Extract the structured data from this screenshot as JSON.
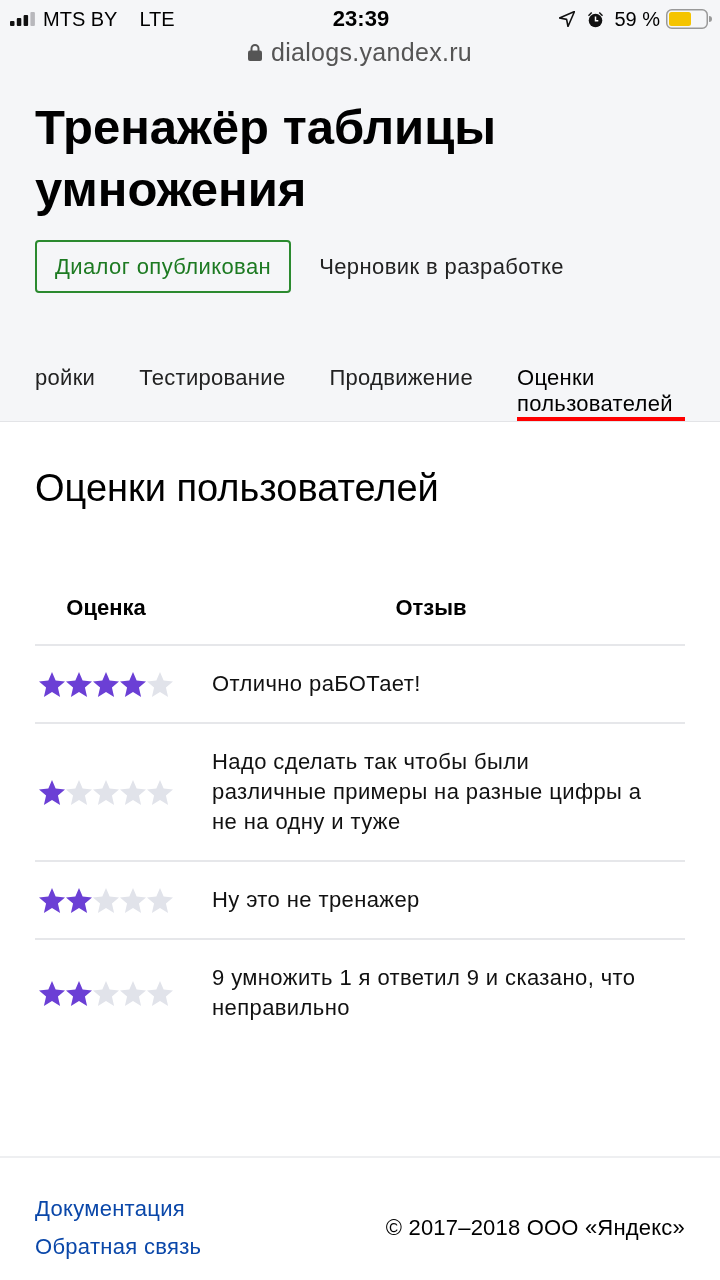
{
  "status_bar": {
    "carrier": "MTS BY",
    "network": "LTE",
    "time": "23:39",
    "battery": "59 %"
  },
  "address_bar": {
    "url": "dialogs.yandex.ru"
  },
  "header": {
    "title": "Тренажёр таблицы умножения",
    "versions": [
      {
        "label": "Диалог опубликован",
        "selected": true
      },
      {
        "label": "Черновик в разработке",
        "selected": false
      }
    ]
  },
  "tabs": [
    {
      "label": "ройки",
      "selected": false
    },
    {
      "label": "Тестирование",
      "selected": false
    },
    {
      "label": "Продвижение",
      "selected": false
    },
    {
      "label": "Оценки пользователей",
      "selected": true
    }
  ],
  "section": {
    "title": "Оценки пользователей"
  },
  "table": {
    "columns": [
      "Оценка",
      "Отзыв"
    ],
    "rows": [
      {
        "stars": 4,
        "review": "Отлично раБОТает!"
      },
      {
        "stars": 1,
        "review": "Надо сделать так чтобы были различные примеры на разные цифры а не на одну и туже"
      },
      {
        "stars": 2,
        "review": "Ну это не тренажер"
      },
      {
        "stars": 2,
        "review": "9 умножить 1 я ответил 9 и сказано, что неправильно"
      }
    ]
  },
  "footer": {
    "links": [
      "Документация",
      "Обратная связь"
    ],
    "copyright": "© 2017–2018 ООО «Яндекс»"
  }
}
